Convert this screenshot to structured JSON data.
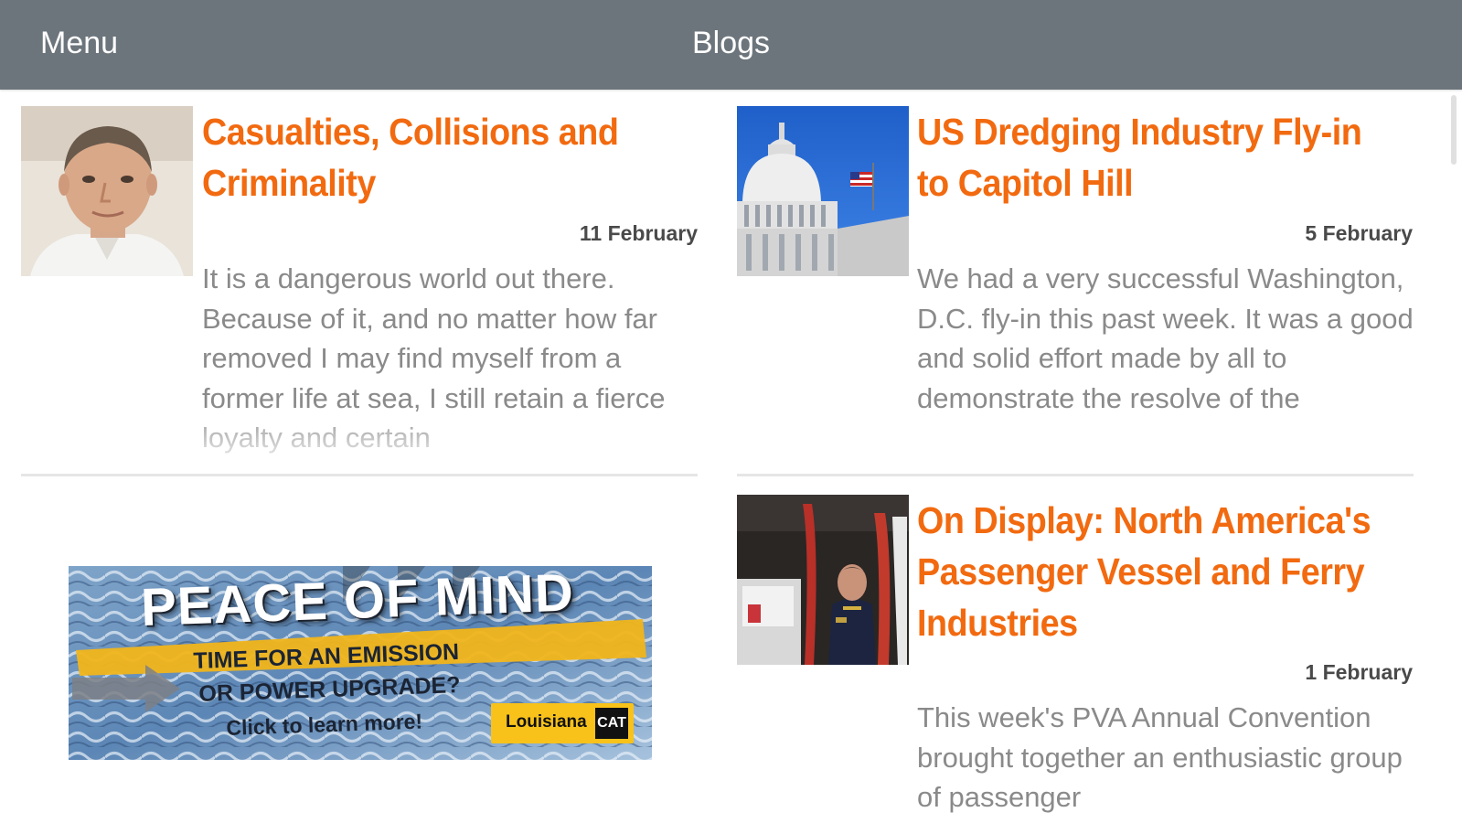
{
  "nav": {
    "menu_label": "Menu",
    "title": "Blogs"
  },
  "colors": {
    "navbar": "#6c757c",
    "accent": "#f26a10",
    "excerpt": "#8a8a8a",
    "date": "#4a4a4a"
  },
  "posts": [
    {
      "title_line1": "Casualties, Collisions and",
      "title_line2": "Criminality",
      "title_line3": "",
      "date": "11 February",
      "excerpt": "It is a dangerous world out there. Because of it, and no matter how far removed I may find myself from a former life at sea, I still retain a fierce loyalty and certain",
      "thumbnail": "portrait-photo"
    },
    {
      "title_line1": "US Dredging Industry Fly-in",
      "title_line2": "to Capitol Hill",
      "title_line3": "",
      "date": "5 February",
      "excerpt": "We had a very successful Washington, D.C. fly-in this past week. It was a good and solid effort made by all to demonstrate the resolve of the",
      "thumbnail": "capitol-dome-photo"
    },
    {
      "title_line1": "On Display: North America's",
      "title_line2": "Passenger Vessel and Ferry",
      "title_line3": "Industries",
      "date": "1 February",
      "excerpt": "This week's PVA Annual Convention brought together an enthusiastic group of passenger",
      "thumbnail": "officer-podium-photo"
    }
  ],
  "ad": {
    "headline": "PEACE OF MIND",
    "line1": "TIME FOR AN EMISSION",
    "line2": "OR POWER UPGRADE?",
    "line3": "Click to learn more!",
    "brand": "Louisiana",
    "brand_badge": "CAT",
    "icon": "arrow-right-icon"
  }
}
